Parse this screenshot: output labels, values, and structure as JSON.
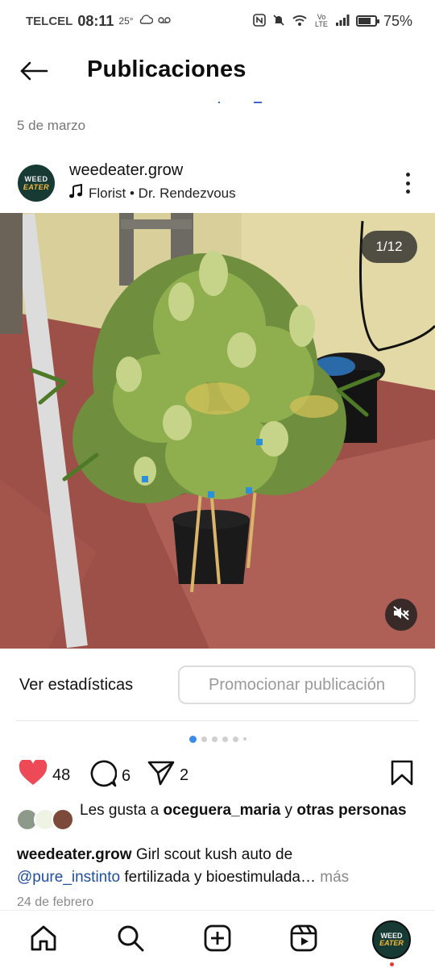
{
  "status_bar": {
    "carrier": "TELCEL",
    "time": "08:11",
    "temperature": "25°",
    "network_label": "Vo LTE",
    "battery_percent": "75%",
    "battery_level": 0.75
  },
  "header": {
    "title": "Publicaciones",
    "back_icon": "arrow-left-icon"
  },
  "date_top": "5 de marzo",
  "post": {
    "username": "weedeater.grow",
    "avatar_text_top": "WEED",
    "avatar_text_bottom": "EATER",
    "music": "Florist • Dr. Rendezvous",
    "music_icon": "music-note-icon",
    "more_icon": "more-vertical-icon",
    "image_counter": "1/12",
    "mute_icon": "volume-off-icon",
    "image_description_icon": "cannabis-plant-photo"
  },
  "insights": {
    "stats_label": "Ver estadísticas",
    "promote_label": "Promocionar publicación"
  },
  "carousel": {
    "total_dots": 6,
    "active_index": 0
  },
  "actions": {
    "likes_count": "48",
    "comments_count": "6",
    "shares_count": "2",
    "like_icon": "heart-filled-icon",
    "comment_icon": "comment-icon",
    "share_icon": "send-icon",
    "save_icon": "bookmark-icon",
    "like_color": "#ed4956"
  },
  "likes_line": {
    "prefix": "Les gusta a ",
    "user": "oceguera_maria",
    "middle": " y ",
    "others": "otras personas"
  },
  "caption": {
    "user": "weedeater.grow",
    "text1": " Girl scout kush auto de",
    "mention": "@pure_instinto",
    "text2": " fertilizada y bioestimulada…",
    "more": " más"
  },
  "date_bottom": "24 de febrero",
  "bottom_nav": {
    "home_icon": "home-icon",
    "search_icon": "search-icon",
    "create_icon": "plus-square-icon",
    "reels_icon": "reels-icon",
    "profile_text_top": "WEED",
    "profile_text_bottom": "EATER"
  },
  "colors": {
    "accent_blue": "#3b8be8",
    "mention": "#1f4e9c",
    "avatar_bg": "#173a34",
    "avatar_accent": "#f6b93b"
  }
}
